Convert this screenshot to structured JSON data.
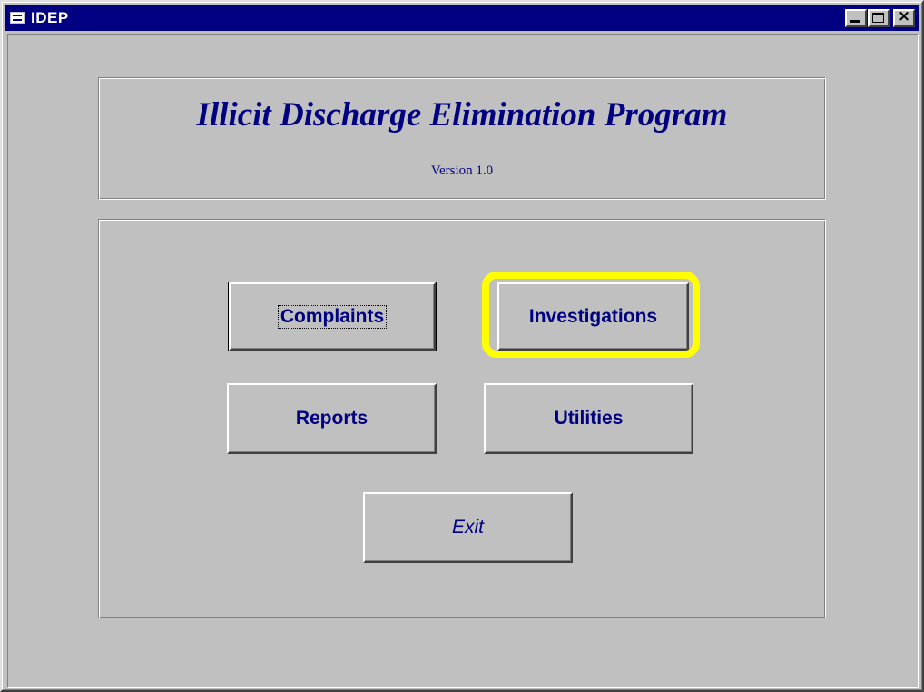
{
  "window": {
    "title": "IDEP",
    "icon": "form-icon",
    "controls": {
      "minimize": "minimize-icon",
      "maximize": "maximize-icon",
      "close_label": "×"
    }
  },
  "header": {
    "title": "Illicit Discharge Elimination Program",
    "version": "Version 1.0"
  },
  "menu": {
    "complaints_label": "Complaints",
    "investigations_label": "Investigations",
    "reports_label": "Reports",
    "utilities_label": "Utilities",
    "exit_label": "Exit"
  },
  "state": {
    "focused_button": "Complaints",
    "highlighted_button": "Investigations",
    "highlight_color": "#ffff00"
  },
  "colors": {
    "titlebar": "#000080",
    "text": "#000080",
    "face": "#c0c0c0"
  }
}
